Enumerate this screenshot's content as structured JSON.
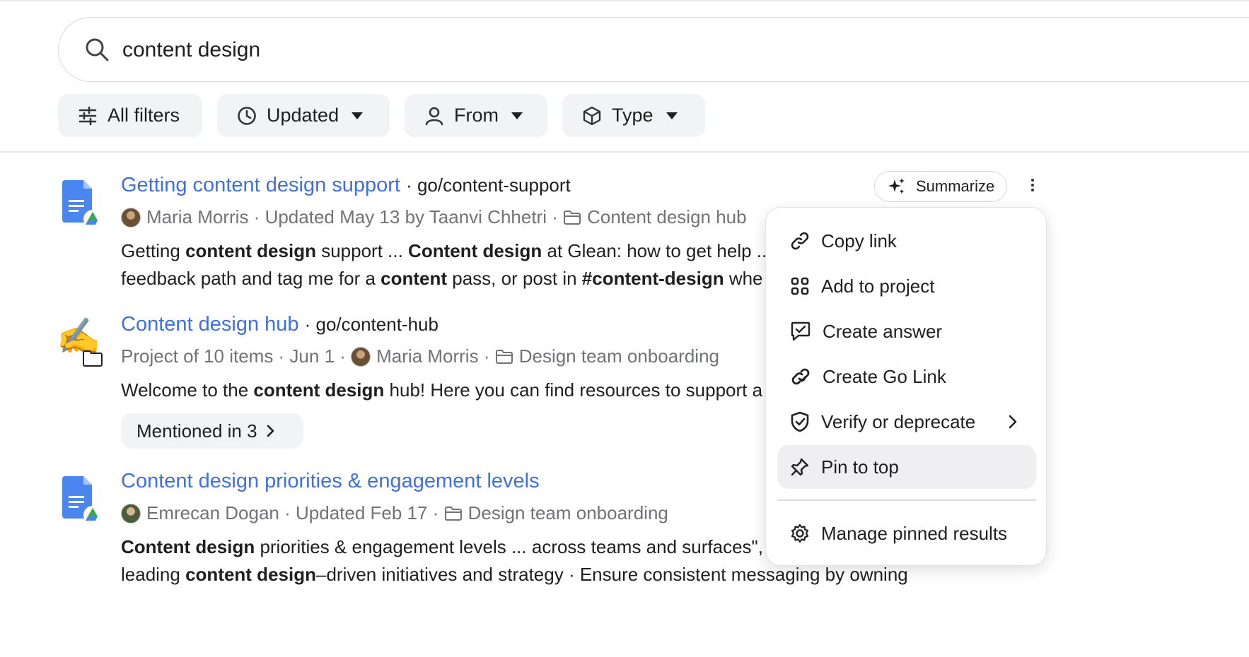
{
  "search": {
    "query": "content design"
  },
  "filters": [
    {
      "label": "All filters",
      "icon": "sliders-icon"
    },
    {
      "label": "Updated",
      "icon": "clock-icon"
    },
    {
      "label": "From",
      "icon": "person-icon"
    },
    {
      "label": "Type",
      "icon": "cube-icon"
    }
  ],
  "actions": {
    "summarize_label": "Summarize"
  },
  "results": [
    {
      "title": "Getting content design support",
      "golink": "go/content-support",
      "author": "Maria Morris",
      "updated": "Updated May 13 by Taanvi Chhetri",
      "folder": "Content design hub",
      "snippet_line1": [
        "Getting ",
        "content design",
        " support ... ",
        "Content design",
        " at Glean: how to get help .."
      ],
      "snippet_line2": [
        "feedback path and tag me for a ",
        "content",
        " pass, or post in ",
        "#content-design",
        " whe"
      ]
    },
    {
      "title": "Content design hub",
      "golink": "go/content-hub",
      "project": "Project of 10 items",
      "date": "Jun 1",
      "author": "Maria Morris",
      "folder": "Design team onboarding",
      "snippet_line1": [
        "Welcome to the ",
        "content design",
        " hub! Here you can find resources to support a"
      ],
      "mentioned": "Mentioned in 3"
    },
    {
      "title": "Content design priorities & engagement levels",
      "author": "Emrecan Dogan",
      "updated": "Updated Feb 17",
      "folder": "Design team onboarding",
      "snippet_line1": [
        "Content design",
        " priorities & engagement levels ... across teams and surfaces\","
      ],
      "snippet_line2": [
        "leading ",
        "content design",
        "–driven initiatives and strategy · Ensure consistent messaging by owning"
      ]
    }
  ],
  "menu": {
    "items": [
      {
        "label": "Copy link",
        "icon": "link-icon"
      },
      {
        "label": "Add to project",
        "icon": "grid-icon"
      },
      {
        "label": "Create answer",
        "icon": "answer-icon"
      },
      {
        "label": "Create Go Link",
        "icon": "golink-icon"
      },
      {
        "label": "Verify or deprecate",
        "icon": "shield-check-icon"
      },
      {
        "label": "Pin to top",
        "icon": "pin-icon"
      },
      {
        "label": "Manage pinned results",
        "icon": "gear-icon"
      }
    ]
  },
  "colors": {
    "link": "#3f6fe0",
    "meta": "#717275",
    "chip_bg": "#f2f3f5",
    "menu_hover": "#efeff1"
  }
}
